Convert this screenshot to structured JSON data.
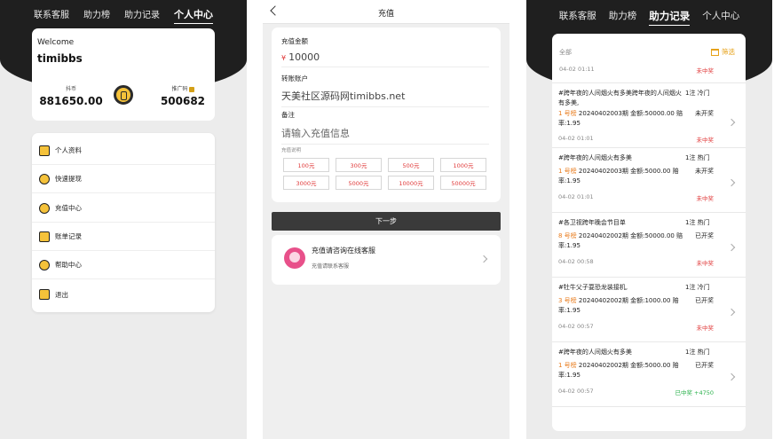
{
  "panel1": {
    "nav": [
      "联系客服",
      "助力榜",
      "助力记录",
      "个人中心"
    ],
    "welcome": "Welcome",
    "username": "timibbs",
    "stat_left_label": "抖币",
    "stat_left_value": "881650.00",
    "stat_right_label": "推广码",
    "stat_right_value": "500682",
    "menu": [
      {
        "label": "个人资料",
        "icon": "profile-icon"
      },
      {
        "label": "快速提现",
        "icon": "withdraw-icon"
      },
      {
        "label": "充值中心",
        "icon": "recharge-icon"
      },
      {
        "label": "账单记录",
        "icon": "bill-icon"
      },
      {
        "label": "帮助中心",
        "icon": "help-icon"
      },
      {
        "label": "退出",
        "icon": "logout-icon"
      }
    ]
  },
  "panel2": {
    "title": "充值",
    "amount_label": "充值金额",
    "currency": "¥",
    "amount_value": "10000",
    "account_label": "转账账户",
    "account_value": "天美社区源码网timibbs.net",
    "note_label": "备注",
    "note_placeholder": "请输入充值信息",
    "desc_label": "充值说明",
    "amounts": [
      "100元",
      "300元",
      "500元",
      "1000元",
      "3000元",
      "5000元",
      "10000元",
      "50000元"
    ],
    "next_button": "下一步",
    "service_title": "充值请咨询在线客服",
    "service_sub": "充值请联系客服"
  },
  "panel3": {
    "nav": [
      "联系客服",
      "助力榜",
      "助力记录",
      "个人中心"
    ],
    "filter_all": "全部",
    "filter_label": "筛选",
    "first_date": "04-02 01:11",
    "first_status": "未中奖",
    "records": [
      {
        "title": "#跨年夜的人间烟火有多美跨年夜的人间烟火有多美,",
        "tag": "1注 冷门",
        "rank": "1 号榜",
        "detail": "20240402003期 金额:50000.00 赔率:1.95",
        "result": "未开奖",
        "date": "04-02 01:01",
        "status": "未中奖",
        "win": false
      },
      {
        "title": "#跨年夜的人间烟火有多美",
        "tag": "1注 热门",
        "rank": "1 号榜",
        "detail": "20240402003期 金额:5000.00 赔率:1.95",
        "result": "未开奖",
        "date": "04-02 01:01",
        "status": "未中奖",
        "win": false
      },
      {
        "title": "#各卫视跨年晚会节目单",
        "tag": "1注 热门",
        "rank": "8 号榜",
        "detail": "20240402002期 金额:50000.00 赔率:1.95",
        "result": "已开奖",
        "date": "04-02 00:58",
        "status": "未中奖",
        "win": false
      },
      {
        "title": "#牡牛父子耍恐龙装接机,",
        "tag": "1注 冷门",
        "rank": "3 号榜",
        "detail": "20240402002期 金额:1000.00 赔率:1.95",
        "result": "已开奖",
        "date": "04-02 00:57",
        "status": "未中奖",
        "win": false
      },
      {
        "title": "#跨年夜的人间烟火有多美",
        "tag": "1注 热门",
        "rank": "1 号榜",
        "detail": "20240402002期 金额:5000.00 赔率:1.95",
        "result": "已开奖",
        "date": "04-02 00:57",
        "status": "已中奖 +4750",
        "win": true
      }
    ]
  }
}
